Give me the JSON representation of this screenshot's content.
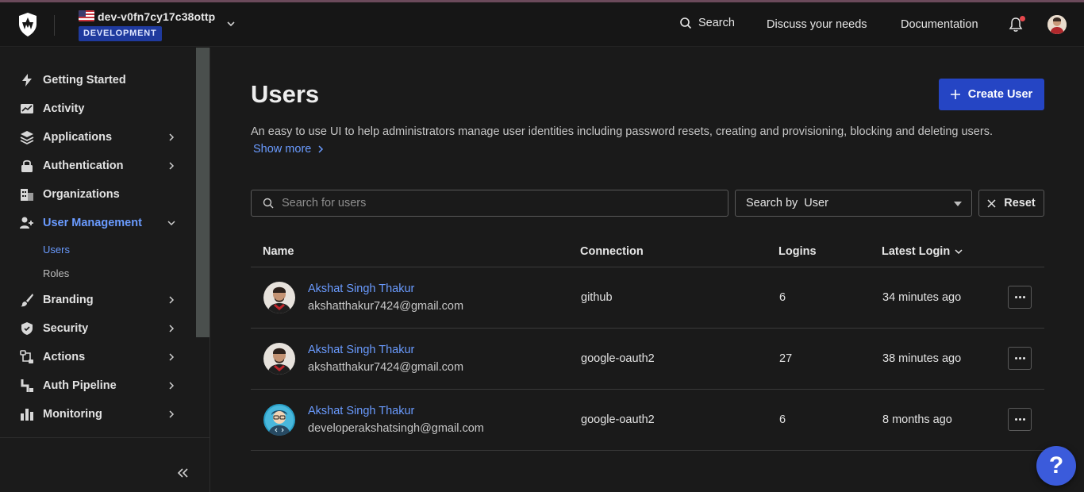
{
  "header": {
    "tenant_name": "dev-v0fn7cy17c38ottp",
    "environment_badge": "DEVELOPMENT",
    "search_label": "Search",
    "discuss_label": "Discuss your needs",
    "docs_label": "Documentation"
  },
  "sidebar": {
    "items": [
      {
        "label": "Getting Started",
        "icon": "lightning-icon"
      },
      {
        "label": "Activity",
        "icon": "chart-icon"
      },
      {
        "label": "Applications",
        "icon": "layers-icon"
      },
      {
        "label": "Authentication",
        "icon": "lock-icon"
      },
      {
        "label": "Organizations",
        "icon": "building-icon"
      },
      {
        "label": "User Management",
        "icon": "users-icon"
      },
      {
        "label": "Branding",
        "icon": "brush-icon"
      },
      {
        "label": "Security",
        "icon": "shield-icon"
      },
      {
        "label": "Actions",
        "icon": "flow-icon"
      },
      {
        "label": "Auth Pipeline",
        "icon": "pipeline-icon"
      },
      {
        "label": "Monitoring",
        "icon": "bar-chart-icon"
      }
    ],
    "sub_items": [
      "Users",
      "Roles"
    ]
  },
  "main": {
    "title": "Users",
    "create_button": "Create User",
    "description": "An easy to use UI to help administrators manage user identities including password resets, creating and provisioning, blocking and deleting users.",
    "show_more": "Show more",
    "search_placeholder": "Search for users",
    "search_by_prefix": "Search by",
    "search_by_value": "User",
    "reset_label": "Reset",
    "columns": {
      "name": "Name",
      "connection": "Connection",
      "logins": "Logins",
      "latest_login": "Latest Login"
    },
    "users": [
      {
        "name": "Akshat Singh Thakur",
        "email": "akshatthakur7424@gmail.com",
        "connection": "github",
        "logins": "6",
        "latest_login": "34 minutes ago"
      },
      {
        "name": "Akshat Singh Thakur",
        "email": "akshatthakur7424@gmail.com",
        "connection": "google-oauth2",
        "logins": "27",
        "latest_login": "38 minutes ago"
      },
      {
        "name": "Akshat Singh Thakur",
        "email": "developerakshatsingh@gmail.com",
        "connection": "google-oauth2",
        "logins": "6",
        "latest_login": "8 months ago"
      }
    ]
  },
  "help_label": "?",
  "colors": {
    "accent": "#2545c4",
    "link": "#6a9bff",
    "badge": "#1f3a9e",
    "notification": "#e5484d"
  }
}
